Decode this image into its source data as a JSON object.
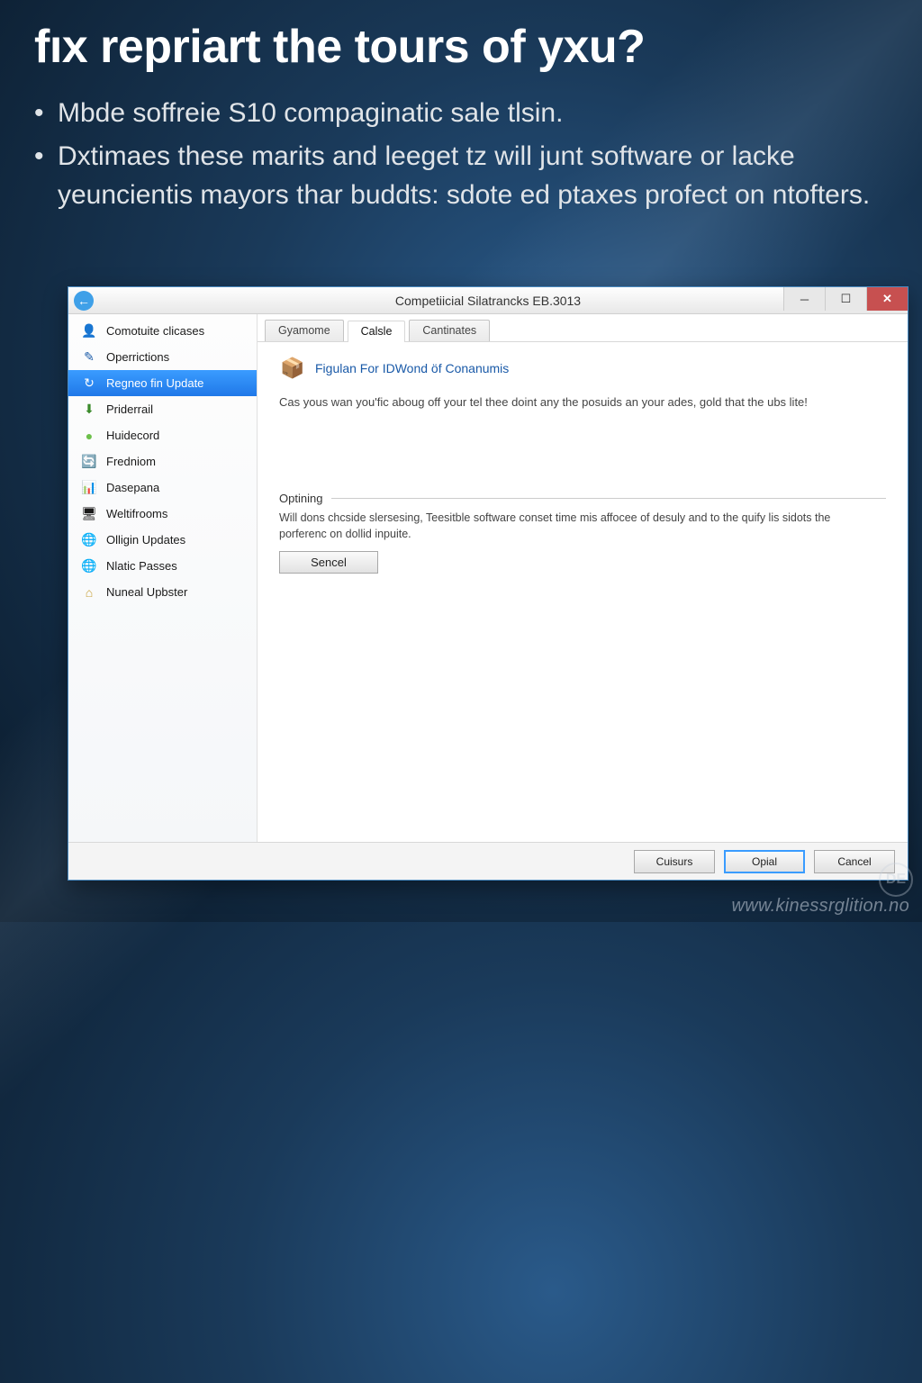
{
  "slide": {
    "title": "fıx repriart the tours of yxu?",
    "bullet1": "Mbde soffreie S10 compaginatic sale tlsin.",
    "bullet2": "Dxtimaes these marits and leeget tz will junt software or lacke yeuncientis mayors thar buddts: sdote ed ptaxes profect on ntofters."
  },
  "window": {
    "title": "Competiicial Silatrancks EB.3013",
    "sidebar": [
      {
        "icon": "user-lock-icon",
        "glyph": "👤",
        "color": "#3a8a2a",
        "label": "Comotuite clicases"
      },
      {
        "icon": "pencil-icon",
        "glyph": "✎",
        "color": "#1a5aa8",
        "label": "Operrictions"
      },
      {
        "icon": "update-arrow-icon",
        "glyph": "↻",
        "color": "#ffffff",
        "label": "Regneo fin Update",
        "selected": true
      },
      {
        "icon": "download-icon",
        "glyph": "⬇",
        "color": "#3a8a2a",
        "label": "Priderrail"
      },
      {
        "icon": "record-icon",
        "glyph": "●",
        "color": "#6cc04a",
        "label": "Huidecord"
      },
      {
        "icon": "refresh-icon",
        "glyph": "🔄",
        "color": "#3a8a2a",
        "label": "Fredniom"
      },
      {
        "icon": "chart-icon",
        "glyph": "📊",
        "color": "#c04a4a",
        "label": "Dasepana"
      },
      {
        "icon": "monitor-icon",
        "glyph": "🖥",
        "color": "#888",
        "label": "Weltifrooms"
      },
      {
        "icon": "globe-icon",
        "glyph": "🌐",
        "color": "#3a8a2a",
        "label": "Olligin Updates"
      },
      {
        "icon": "globe-icon",
        "glyph": "🌐",
        "color": "#2a5aa8",
        "label": "Nlatic Passes"
      },
      {
        "icon": "home-icon",
        "glyph": "⌂",
        "color": "#c8a038",
        "label": "Nuneal Upbster"
      }
    ],
    "tabs": [
      {
        "label": "Gyamome",
        "active": false
      },
      {
        "label": "Calsle",
        "active": true
      },
      {
        "label": "Cantinates",
        "active": false
      }
    ],
    "pane": {
      "heading": "Figulan For IDWond öf Conanumis",
      "desc": "Cas yous wan you'fic aboug off your tel thee doint any the posuids an your ades, gold that the ubs lite!",
      "section_label": "Optining",
      "section_desc": "Will dons chcside slersesing, Teesitble software conset time mis affocee of desuly and to the quify lis sidots the porferenc on dollid inpuite.",
      "inline_button": "Sencel"
    },
    "footer": {
      "btn1": "Cuisurs",
      "btn2": "Opial",
      "btn3": "Cancel"
    }
  },
  "watermark": "www.kinessrglition.no",
  "watermark_badge": "DE"
}
